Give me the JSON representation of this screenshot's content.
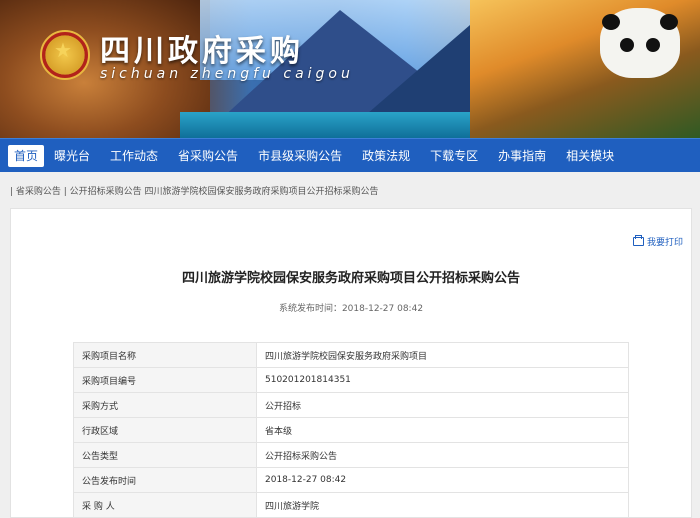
{
  "header": {
    "title": "四川政府采购",
    "subtitle": "sichuan zhengfu caigou"
  },
  "nav": {
    "items": [
      "首页",
      "曝光台",
      "工作动态",
      "省采购公告",
      "市县级采购公告",
      "政策法规",
      "下载专区",
      "办事指南",
      "相关模块"
    ]
  },
  "breadcrumb": {
    "text": "| 省采购公告  | 公开招标采购公告  四川旅游学院校园保安服务政府采购项目公开招标采购公告"
  },
  "toolbar": {
    "print_label": "我要打印"
  },
  "article": {
    "title": "四川旅游学院校园保安服务政府采购项目公开招标采购公告",
    "published": "系统发布时间：2018-12-27 08:42"
  },
  "info_table": [
    {
      "key": "采购项目名称",
      "value": "四川旅游学院校园保安服务政府采购项目"
    },
    {
      "key": "采购项目编号",
      "value": "510201201814351"
    },
    {
      "key": "采购方式",
      "value": "公开招标"
    },
    {
      "key": "行政区域",
      "value": "省本级"
    },
    {
      "key": "公告类型",
      "value": "公开招标采购公告"
    },
    {
      "key": "公告发布时间",
      "value": "2018-12-27 08:42"
    },
    {
      "key": "采 购 人",
      "value": "四川旅游学院"
    }
  ],
  "colors": {
    "nav_bg": "#1f5fbf",
    "accent": "#1f5fbf"
  },
  "icons": {
    "emblem": "national-emblem-icon",
    "print": "printer-icon"
  }
}
